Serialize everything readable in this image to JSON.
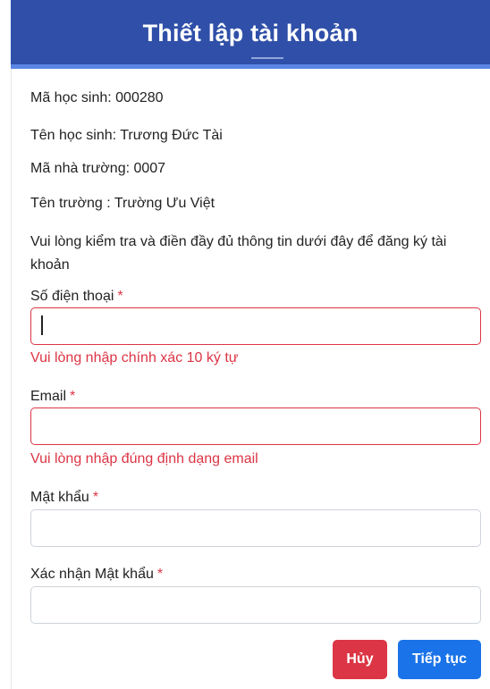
{
  "header": {
    "title": "Thiết lập tài khoản"
  },
  "info": {
    "student_id": "Mã học sinh: 000280",
    "student_name": "Tên học sinh: Trương Đức Tài",
    "school_id": "Mã nhà trường: 0007",
    "school_name": "Tên trường : Trường Ưu Việt",
    "instruction": "Vui lòng kiểm tra và điền đầy đủ thông tin dưới đây để đăng ký tài khoản"
  },
  "form": {
    "required_mark": "*",
    "phone": {
      "label": "Số điện thoại",
      "value": "",
      "error": "Vui lòng nhập chính xác 10 ký tự"
    },
    "email": {
      "label": "Email",
      "value": "",
      "error": "Vui lòng nhập đúng định dạng email"
    },
    "password": {
      "label": "Mật khẩu",
      "value": ""
    },
    "confirm_password": {
      "label": "Xác nhận Mật khẩu",
      "value": ""
    }
  },
  "buttons": {
    "cancel": "Hủy",
    "next": "Tiếp tục"
  },
  "colors": {
    "header": "#2f4fa8",
    "error": "#dc3545",
    "primary": "#1a73e8"
  }
}
